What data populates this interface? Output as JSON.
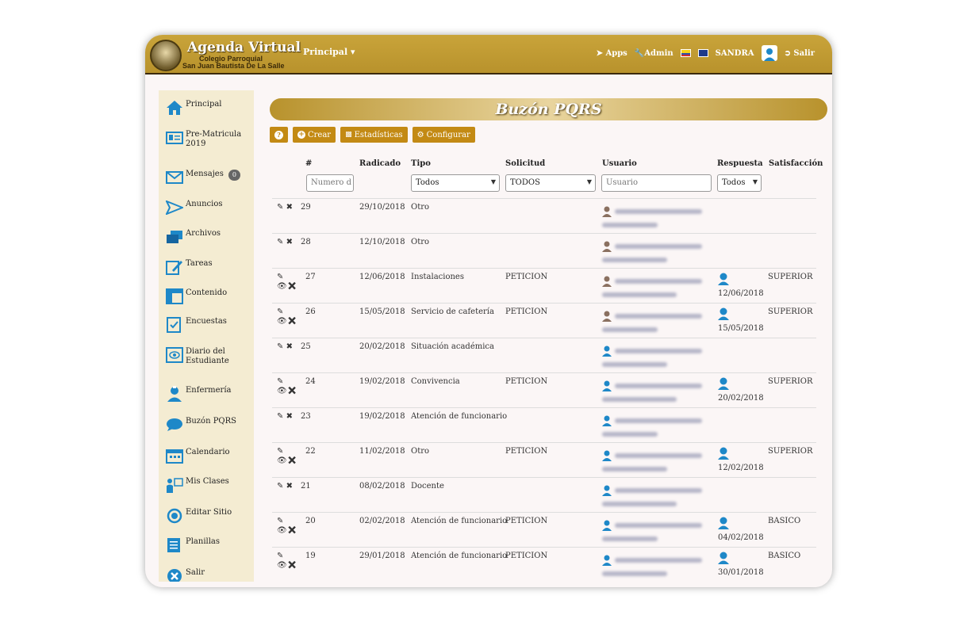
{
  "app": {
    "title": "Agenda Virtual",
    "subtitle_line1": "Colegio Parroquial",
    "subtitle_line2": "San Juan Bautista De La Salle"
  },
  "navbar": {
    "principal": "Principal ▾",
    "apps": "Apps",
    "admin": "Admin",
    "user": "SANDRA",
    "salir": "Salir"
  },
  "sidebar": {
    "items": [
      {
        "label": "Principal",
        "icon": "home-icon"
      },
      {
        "label": "Pre-Matricula 2019",
        "icon": "id-card-icon"
      },
      {
        "label": "Mensajes",
        "icon": "envelope-icon",
        "badge": "0"
      },
      {
        "label": "Anuncios",
        "icon": "paper-plane-icon"
      },
      {
        "label": "Archivos",
        "icon": "folders-icon"
      },
      {
        "label": "Tareas",
        "icon": "edit-icon"
      },
      {
        "label": "Contenido",
        "icon": "layout-icon"
      },
      {
        "label": "Encuestas",
        "icon": "checklist-icon"
      },
      {
        "label": "Diario del Estudiante",
        "icon": "eye-doc-icon"
      },
      {
        "label": "Enfermería",
        "icon": "nurse-icon"
      },
      {
        "label": "Buzón PQRS",
        "icon": "chat-icon"
      },
      {
        "label": "Calendario",
        "icon": "calendar-icon"
      },
      {
        "label": "Mis Clases",
        "icon": "teacher-icon"
      },
      {
        "label": "Editar Sitio",
        "icon": "circle-icon"
      },
      {
        "label": "Planillas",
        "icon": "sheet-icon"
      },
      {
        "label": "Salir",
        "icon": "close-circle-icon"
      }
    ]
  },
  "page": {
    "title": "Buzón PQRS"
  },
  "toolbar": {
    "help": "?",
    "crear": "Crear",
    "estadisticas": "Estadísticas",
    "configurar": "Configurar"
  },
  "table": {
    "headers": {
      "num": "#",
      "radicado": "Radicado",
      "tipo": "Tipo",
      "solicitud": "Solicitud",
      "usuario": "Usuario",
      "respuesta": "Respuesta",
      "satisfaccion": "Satisfacción"
    },
    "filters": {
      "num_placeholder": "Numero d",
      "tipo": "Todos",
      "solicitud": "TODOS",
      "usuario_placeholder": "Usuario",
      "respuesta": "Todos"
    },
    "rows": [
      {
        "id": "29",
        "radicado": "29/10/2018",
        "tipo": "Otro",
        "solicitud": "",
        "respuesta_fecha": "",
        "satisfaccion": ""
      },
      {
        "id": "28",
        "radicado": "12/10/2018",
        "tipo": "Otro",
        "solicitud": "",
        "respuesta_fecha": "",
        "satisfaccion": ""
      },
      {
        "id": "27",
        "radicado": "12/06/2018",
        "tipo": "Instalaciones",
        "solicitud": "PETICION",
        "respuesta_fecha": "12/06/2018",
        "satisfaccion": "SUPERIOR"
      },
      {
        "id": "26",
        "radicado": "15/05/2018",
        "tipo": "Servicio de cafetería",
        "solicitud": "PETICION",
        "respuesta_fecha": "15/05/2018",
        "satisfaccion": "SUPERIOR"
      },
      {
        "id": "25",
        "radicado": "20/02/2018",
        "tipo": "Situación académica",
        "solicitud": "",
        "respuesta_fecha": "",
        "satisfaccion": ""
      },
      {
        "id": "24",
        "radicado": "19/02/2018",
        "tipo": "Convivencia",
        "solicitud": "PETICION",
        "respuesta_fecha": "20/02/2018",
        "satisfaccion": "SUPERIOR"
      },
      {
        "id": "23",
        "radicado": "19/02/2018",
        "tipo": "Atención de funcionario",
        "solicitud": "",
        "respuesta_fecha": "",
        "satisfaccion": ""
      },
      {
        "id": "22",
        "radicado": "11/02/2018",
        "tipo": "Otro",
        "solicitud": "PETICION",
        "respuesta_fecha": "12/02/2018",
        "satisfaccion": "SUPERIOR"
      },
      {
        "id": "21",
        "radicado": "08/02/2018",
        "tipo": "Docente",
        "solicitud": "",
        "respuesta_fecha": "",
        "satisfaccion": ""
      },
      {
        "id": "20",
        "radicado": "02/02/2018",
        "tipo": "Atención de funcionario",
        "solicitud": "PETICION",
        "respuesta_fecha": "04/02/2018",
        "satisfaccion": "BASICO"
      },
      {
        "id": "19",
        "radicado": "29/01/2018",
        "tipo": "Atención de funcionario",
        "solicitud": "PETICION",
        "respuesta_fecha": "30/01/2018",
        "satisfaccion": "BASICO"
      }
    ]
  },
  "colors": {
    "gold": "#b8922c",
    "button": "#c38a14",
    "accent_blue": "#1e88c8"
  }
}
